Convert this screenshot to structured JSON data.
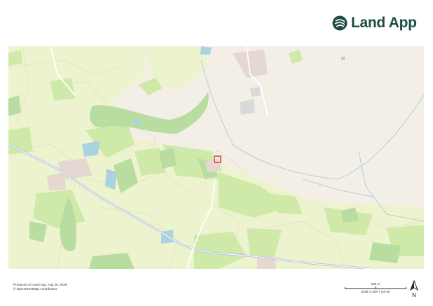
{
  "brand": {
    "name": "Land App",
    "logo_icon": "leaf-globe-icon",
    "color": "#1e4d44"
  },
  "map": {
    "description_colors": {
      "field": "#eef3cf",
      "grass": "#cfe9a8",
      "wood": "#b9dca0",
      "water": "#aad3df",
      "urban": "#f3efe6",
      "road": "#ffffff"
    },
    "marker_color": "#d7191c"
  },
  "footer": {
    "produced": "Produced on Land App, Aug 25, 2026.",
    "credit": "© OpenStreetMap contributors"
  },
  "scale": {
    "distance_label": "500 m",
    "ratio_label": "Scale 1:15077 (at A4)"
  },
  "north": {
    "label": "N",
    "icon": "north-arrow-icon"
  }
}
